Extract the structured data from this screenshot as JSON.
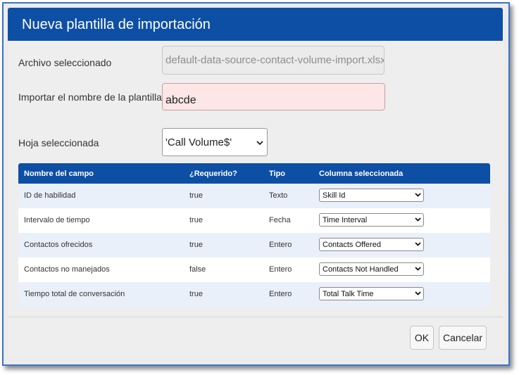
{
  "dialog": {
    "title": "Nueva plantilla de importación",
    "selected_file_label": "Archivo seleccionado",
    "selected_file_value": "default-data-source-contact-volume-import.xlsx",
    "template_name_label": "Importar el nombre de la plantilla",
    "template_name_value": "abcde",
    "sheet_label": "Hoja seleccionada",
    "sheet_value": "'Call Volume$'",
    "ok_label": "OK",
    "cancel_label": "Cancelar"
  },
  "table": {
    "headers": [
      "Nombre del campo",
      "¿Requerido?",
      "Tipo",
      "Columna seleccionada"
    ],
    "rows": [
      {
        "field": "ID de habilidad",
        "required": "true",
        "type": "Texto",
        "column": "Skill Id"
      },
      {
        "field": "Intervalo de tiempo",
        "required": "true",
        "type": "Fecha",
        "column": "Time Interval"
      },
      {
        "field": "Contactos ofrecidos",
        "required": "true",
        "type": "Entero",
        "column": "Contacts Offered"
      },
      {
        "field": "Contactos no manejados",
        "required": "false",
        "type": "Entero",
        "column": "Contacts Not Handled"
      },
      {
        "field": "Tiempo total de conversación",
        "required": "true",
        "type": "Entero",
        "column": "Total Talk Time"
      }
    ]
  },
  "colors": {
    "header_blue": "#0e4fa6",
    "row_alt": "#e9f0f9",
    "invalid_field_bg": "#fde6e6"
  }
}
